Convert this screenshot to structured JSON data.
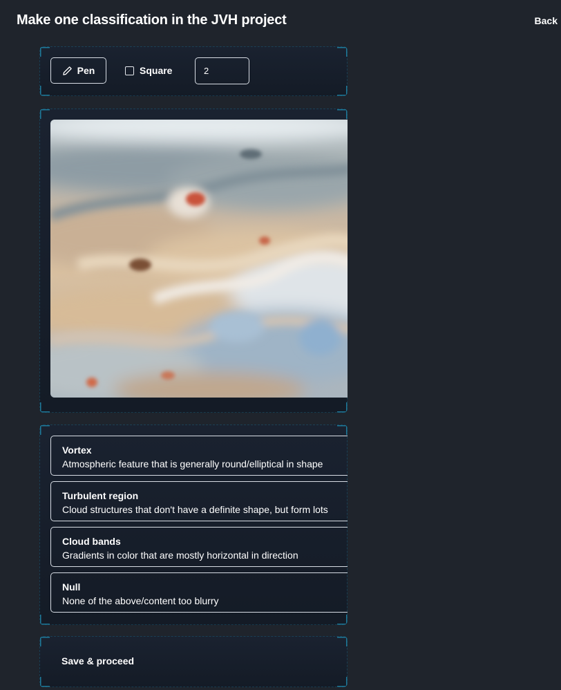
{
  "header": {
    "title": "Make one classification in the JVH project",
    "back_label": "Back"
  },
  "toolbar": {
    "pen_label": "Pen",
    "pen_icon": "pencil-icon",
    "square_label": "Square",
    "square_checked": false,
    "brush_size": "2"
  },
  "image": {
    "alt": "Jupiter cloud bands"
  },
  "options": [
    {
      "title": "Vortex",
      "description": "Atmospheric feature that is generally round/elliptical in shape"
    },
    {
      "title": "Turbulent region",
      "description": "Cloud structures that don't have a definite shape, but form lots"
    },
    {
      "title": "Cloud bands",
      "description": "Gradients in color that are mostly horizontal in direction"
    },
    {
      "title": "Null",
      "description": "None of the above/content too blurry"
    }
  ],
  "actions": {
    "save_label": "Save & proceed"
  },
  "colors": {
    "background": "#1f242c",
    "panel": "#18202c",
    "accent_corner": "#1f7a9a",
    "border": "#d8dde5"
  }
}
